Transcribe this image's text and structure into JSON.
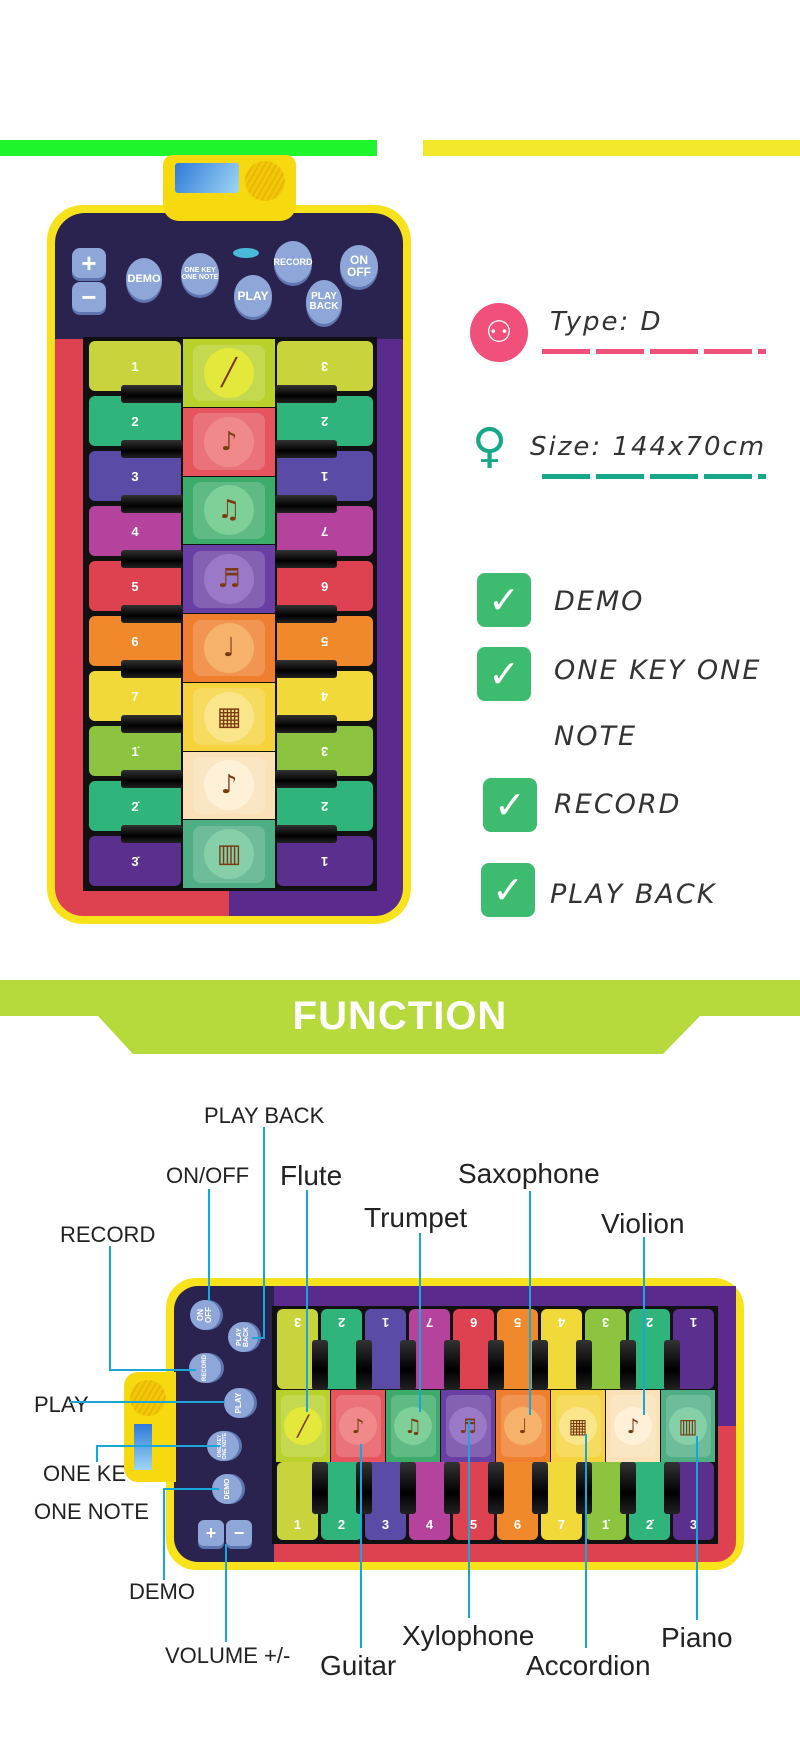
{
  "top_bars": {
    "left_color": "#1ef52c",
    "right_color": "#f3e92c"
  },
  "mat": {
    "buttons": {
      "volume_up": "+",
      "volume_down": "−",
      "demo": "DEMO",
      "one_key_one_note": "ONE KEY ONE NOTE",
      "play": "PLAY",
      "record": "RECORD",
      "on_off": "ON OFF",
      "play_back": "PLAY BACK"
    },
    "left_labels": [
      "1",
      "2",
      "3",
      "4",
      "5",
      "6",
      "7",
      "1̇",
      "2̇",
      "3̇"
    ],
    "right_labels": [
      "3",
      "2",
      "1",
      "7",
      "6",
      "5",
      "4",
      "3",
      "2",
      "1"
    ],
    "key_colors": [
      "#c9d33c",
      "#2fb47b",
      "#5a4ba6",
      "#b5429c",
      "#de4150",
      "#ef892b",
      "#f1d93a",
      "#8cc43f",
      "#2fb47b",
      "#5b2f8e"
    ],
    "instruments": [
      {
        "icon": "flute-icon",
        "glyph": "╱",
        "tile": "#b9d12a",
        "circle": "#e3e83a"
      },
      {
        "icon": "guitar-icon",
        "glyph": "♪",
        "tile": "#e6555e",
        "circle": "#f08a8a"
      },
      {
        "icon": "trumpet-icon",
        "glyph": "♫",
        "tile": "#3dab6a",
        "circle": "#7fcf98"
      },
      {
        "icon": "xylophone-icon",
        "glyph": "♬",
        "tile": "#6a3fa3",
        "circle": "#9a7ac8"
      },
      {
        "icon": "saxophone-icon",
        "glyph": "♩",
        "tile": "#ef7e2e",
        "circle": "#f6b26b"
      },
      {
        "icon": "accordion-icon",
        "glyph": "▦",
        "tile": "#f6d23d",
        "circle": "#fbe58a"
      },
      {
        "icon": "violin-icon",
        "glyph": "♪",
        "tile": "#fae1b8",
        "circle": "#fff0d8"
      },
      {
        "icon": "piano-icon",
        "glyph": "▥",
        "tile": "#4fae83",
        "circle": "#86cfa8"
      }
    ]
  },
  "specs": {
    "type_label": "Type: D",
    "size_label": "Size: 144x70cm",
    "type_color": "#f0507a",
    "size_color": "#17a88a"
  },
  "features": [
    "DEMO",
    "ONE KEY ONE",
    "NOTE",
    "RECORD",
    "PLAY BACK"
  ],
  "function_banner": {
    "title": "FUNCTION",
    "color": "#b6d93c"
  },
  "callouts": {
    "play_back": "PLAY BACK",
    "on_off": "ON/OFF",
    "record": "RECORD",
    "play": "PLAY",
    "one_key": "ONE KEY",
    "one_note": "ONE NOTE",
    "demo": "DEMO",
    "volume": "VOLUME +/-",
    "flute": "Flute",
    "trumpet": "Trumpet",
    "saxophone": "Saxophone",
    "violion": "Violion",
    "guitar": "Guitar",
    "xylophone": "Xylophone",
    "accordion": "Accordion",
    "piano": "Piano",
    "line_color": "#1aa7d8"
  }
}
